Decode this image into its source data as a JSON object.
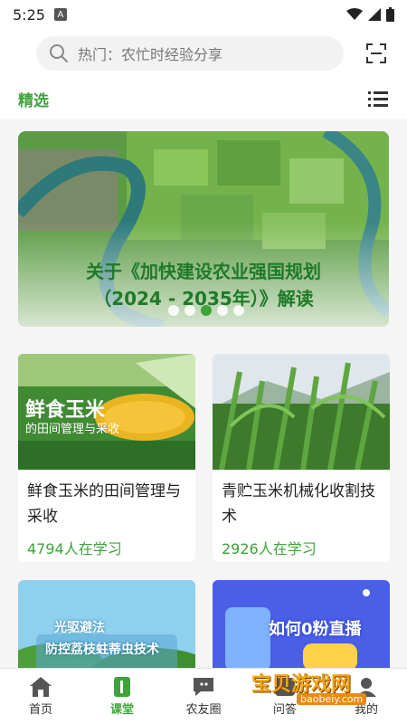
{
  "status": {
    "time": "5:25",
    "badge": "A"
  },
  "search": {
    "placeholder": "热门：农忙时经验分享"
  },
  "tabs": {
    "selected": "精选"
  },
  "banner": {
    "line1": "关于《加快建设农业强国规划",
    "line2": "（2024 - 2035年）》解读",
    "dots": 5,
    "active_dot": 3
  },
  "cards": [
    {
      "thumb_title": "鲜食玉米",
      "thumb_sub": "的田间管理与采收",
      "title": "鲜食玉米的田间管理与采收",
      "learners": "4794人在学习"
    },
    {
      "title": "青贮玉米机械化收割技术",
      "learners": "2926人在学习"
    },
    {
      "thumb_line1": "光驱避法",
      "thumb_line2": "防控荔枝蛀蒂虫技术"
    },
    {
      "thumb_text": "如何0粉直播"
    }
  ],
  "nav": [
    {
      "label": "首页",
      "icon": "home-icon"
    },
    {
      "label": "课堂",
      "icon": "book-icon"
    },
    {
      "label": "农友圈",
      "icon": "chat-icon"
    },
    {
      "label": "问答",
      "icon": "question-icon"
    },
    {
      "label": "我的",
      "icon": "user-icon"
    }
  ],
  "watermark": {
    "text": "宝贝游戏网",
    "url": "baobeiy.com"
  },
  "colors": {
    "accent": "#3ea33a",
    "background": "#f4f5f4"
  }
}
